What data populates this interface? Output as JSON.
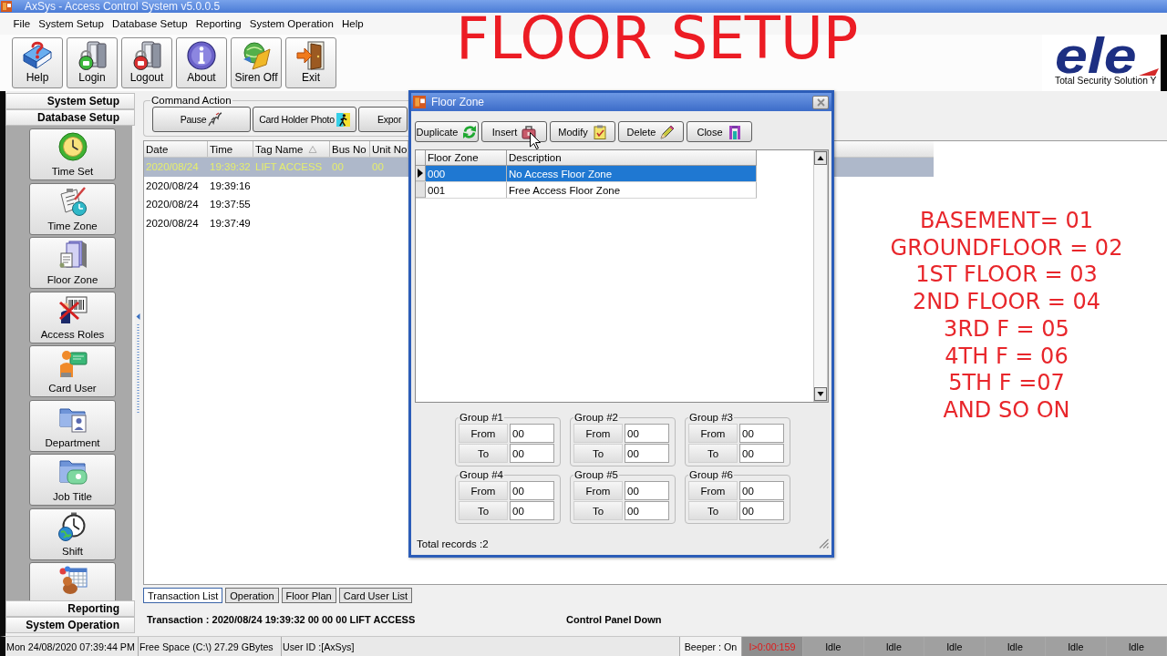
{
  "window": {
    "title": "AxSys - Access Control System v5.0.0.5"
  },
  "menu": [
    "File",
    "System Setup",
    "Database Setup",
    "Reporting",
    "System Operation",
    "Help"
  ],
  "toolbar": [
    "Help",
    "Login",
    "Logout",
    "About",
    "Siren Off",
    "Exit"
  ],
  "logo": {
    "brand": "ele",
    "tagline": "Total Security Solution Y"
  },
  "overlay": {
    "title": "FLOOR SETUP",
    "notes": [
      "BASEMENT= 01",
      "GROUNDFLOOR = 02",
      "1ST FLOOR = 03",
      "2ND FLOOR = 04",
      "3RD F = 05",
      "4TH F = 06",
      "5TH F =07",
      "AND SO ON"
    ]
  },
  "sidebar": {
    "top_sections": [
      "System Setup",
      "Database Setup"
    ],
    "items": [
      "Time Set",
      "Time Zone",
      "Floor Zone",
      "Access Roles",
      "Card User",
      "Department",
      "Job Title",
      "Shift"
    ],
    "clipped_item": true,
    "bottom_sections": [
      "Reporting",
      "System Operation"
    ]
  },
  "command_action": {
    "title": "Command Action",
    "buttons": [
      "Pause",
      "Card Holder Photo",
      "Expor"
    ]
  },
  "table": {
    "columns": [
      "Date",
      "Time",
      "Tag Name",
      "Bus No",
      "Unit No"
    ],
    "rows": [
      {
        "cells": [
          "2020/08/24",
          "19:39:32",
          "LIFT ACCESS",
          "00",
          "00"
        ],
        "selected": true
      },
      {
        "cells": [
          "2020/08/24",
          "19:39:16"
        ],
        "selected": false
      },
      {
        "cells": [
          "2020/08/24",
          "19:37:55"
        ],
        "selected": false
      },
      {
        "cells": [
          "2020/08/24",
          "19:37:49"
        ],
        "selected": false
      }
    ]
  },
  "tabs": [
    {
      "label": "Transaction List",
      "selected": true
    },
    {
      "label": "Operation",
      "selected": false
    },
    {
      "label": "Floor Plan",
      "selected": false
    },
    {
      "label": "Card User List",
      "selected": false
    }
  ],
  "transaction": {
    "message": "Transaction : 2020/08/24 19:39:32 00 00 00 LIFT ACCESS",
    "panel_status": "Control Panel Down"
  },
  "status_bar": {
    "datetime": "Mon 24/08/2020 07:39:44 PM",
    "free_space": "Free Space (C:\\) 27.29 GBytes",
    "user": "User ID :[AxSys]",
    "beeper": "Beeper : On",
    "timer": "I>0:00:159",
    "ports": [
      "Idle",
      "Idle",
      "Idle",
      "Idle",
      "Idle",
      "Idle"
    ]
  },
  "dialog": {
    "title": "Floor Zone",
    "buttons": [
      "Duplicate",
      "Insert",
      "Modify",
      "Delete",
      "Close"
    ],
    "columns": [
      "Floor Zone",
      "Description"
    ],
    "rows": [
      {
        "zone": "000",
        "description": "No Access Floor Zone",
        "selected": true
      },
      {
        "zone": "001",
        "description": "Free Access Floor Zone",
        "selected": false
      }
    ],
    "groups": [
      {
        "title": "Group #1",
        "from_label": "From",
        "from": "00",
        "to_label": "To",
        "to": "00"
      },
      {
        "title": "Group #2",
        "from_label": "From",
        "from": "00",
        "to_label": "To",
        "to": "00"
      },
      {
        "title": "Group #3",
        "from_label": "From",
        "from": "00",
        "to_label": "To",
        "to": "00"
      },
      {
        "title": "Group #4",
        "from_label": "From",
        "from": "00",
        "to_label": "To",
        "to": "00"
      },
      {
        "title": "Group #5",
        "from_label": "From",
        "from": "00",
        "to_label": "To",
        "to": "00"
      },
      {
        "title": "Group #6",
        "from_label": "From",
        "from": "00",
        "to_label": "To",
        "to": "00"
      }
    ],
    "footer": "Total records :2"
  }
}
